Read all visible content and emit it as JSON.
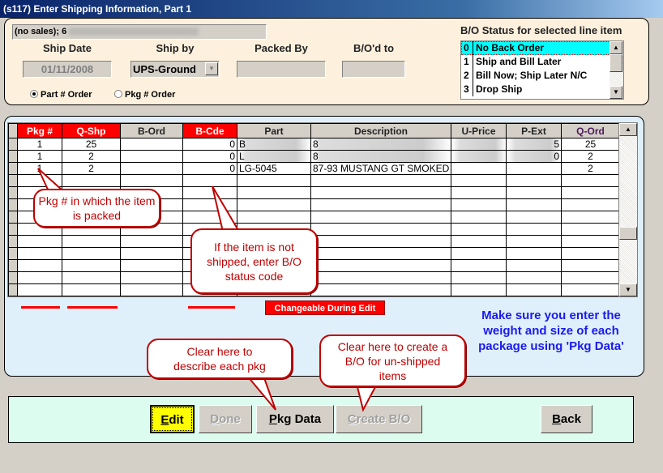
{
  "window": {
    "title": "(s117)  Enter Shipping Information, Part 1"
  },
  "header": {
    "info_prefix": "(no sales); 6",
    "ship_date": {
      "label": "Ship Date",
      "value": "01/11/2008"
    },
    "ship_by": {
      "label": "Ship by",
      "value": "UPS-Ground"
    },
    "packed_by": {
      "label": "Packed By",
      "value": ""
    },
    "bo_to": {
      "label": "B/O'd to",
      "value": ""
    },
    "order_options": [
      {
        "label": "Part # Order",
        "selected": true
      },
      {
        "label": "Pkg # Order",
        "selected": false
      }
    ]
  },
  "bo_status": {
    "label": "B/O Status for selected line item",
    "items": [
      {
        "code": "0",
        "text": "No Back Order",
        "selected": true
      },
      {
        "code": "1",
        "text": "Ship and Bill Later"
      },
      {
        "code": "2",
        "text": "Bill Now; Ship Later N/C"
      },
      {
        "code": "3",
        "text": "Drop Ship"
      }
    ]
  },
  "grid": {
    "columns": [
      "Pkg #",
      "Q-Shp",
      "B-Ord",
      "B-Cde",
      "Part",
      "Description",
      "U-Price",
      "P-Ext",
      "Q-Ord"
    ],
    "rows": [
      {
        "pkg": "1",
        "qshp": "25",
        "bord": "",
        "bcde": "0",
        "part": "B",
        "desc": "8",
        "uprice": "",
        "pext": "5",
        "qord": "25"
      },
      {
        "pkg": "1",
        "qshp": "2",
        "bord": "",
        "bcde": "0",
        "part": "L",
        "desc": "8",
        "uprice": "",
        "pext": "0",
        "qord": "2"
      },
      {
        "pkg": "1",
        "qshp": "2",
        "bord": "",
        "bcde": "0",
        "part": "LG-5045",
        "desc": "87-93 MUSTANG GT SMOKED",
        "uprice": "",
        "pext": "",
        "qord": "2"
      }
    ],
    "changeable_label": "Changeable During Edit"
  },
  "note": "Make sure you enter the weight and size of each package using 'Pkg Data'",
  "callouts": {
    "pkg": "Pkg # in which the item is packed",
    "bcde": "If the item is not shipped, enter B/O status code",
    "pkgdata": "Clear here to describe each pkg",
    "createbo": "Clear here to create a B/O for un-shipped items"
  },
  "buttons": {
    "edit": {
      "key": "E",
      "rest": "dit"
    },
    "done": {
      "key": "D",
      "rest": "one"
    },
    "pkg_data": {
      "key": "P",
      "rest": "kg Data"
    },
    "create_bo": {
      "key": "C",
      "rest": "reate B/O"
    },
    "back": {
      "key": "B",
      "rest": "ack"
    }
  },
  "colors": {
    "title_bar": "#0a246a",
    "editable_header": "#ff0000",
    "selection": "#00ffff",
    "note_text": "#1a1aee",
    "callout": "#c00000"
  }
}
